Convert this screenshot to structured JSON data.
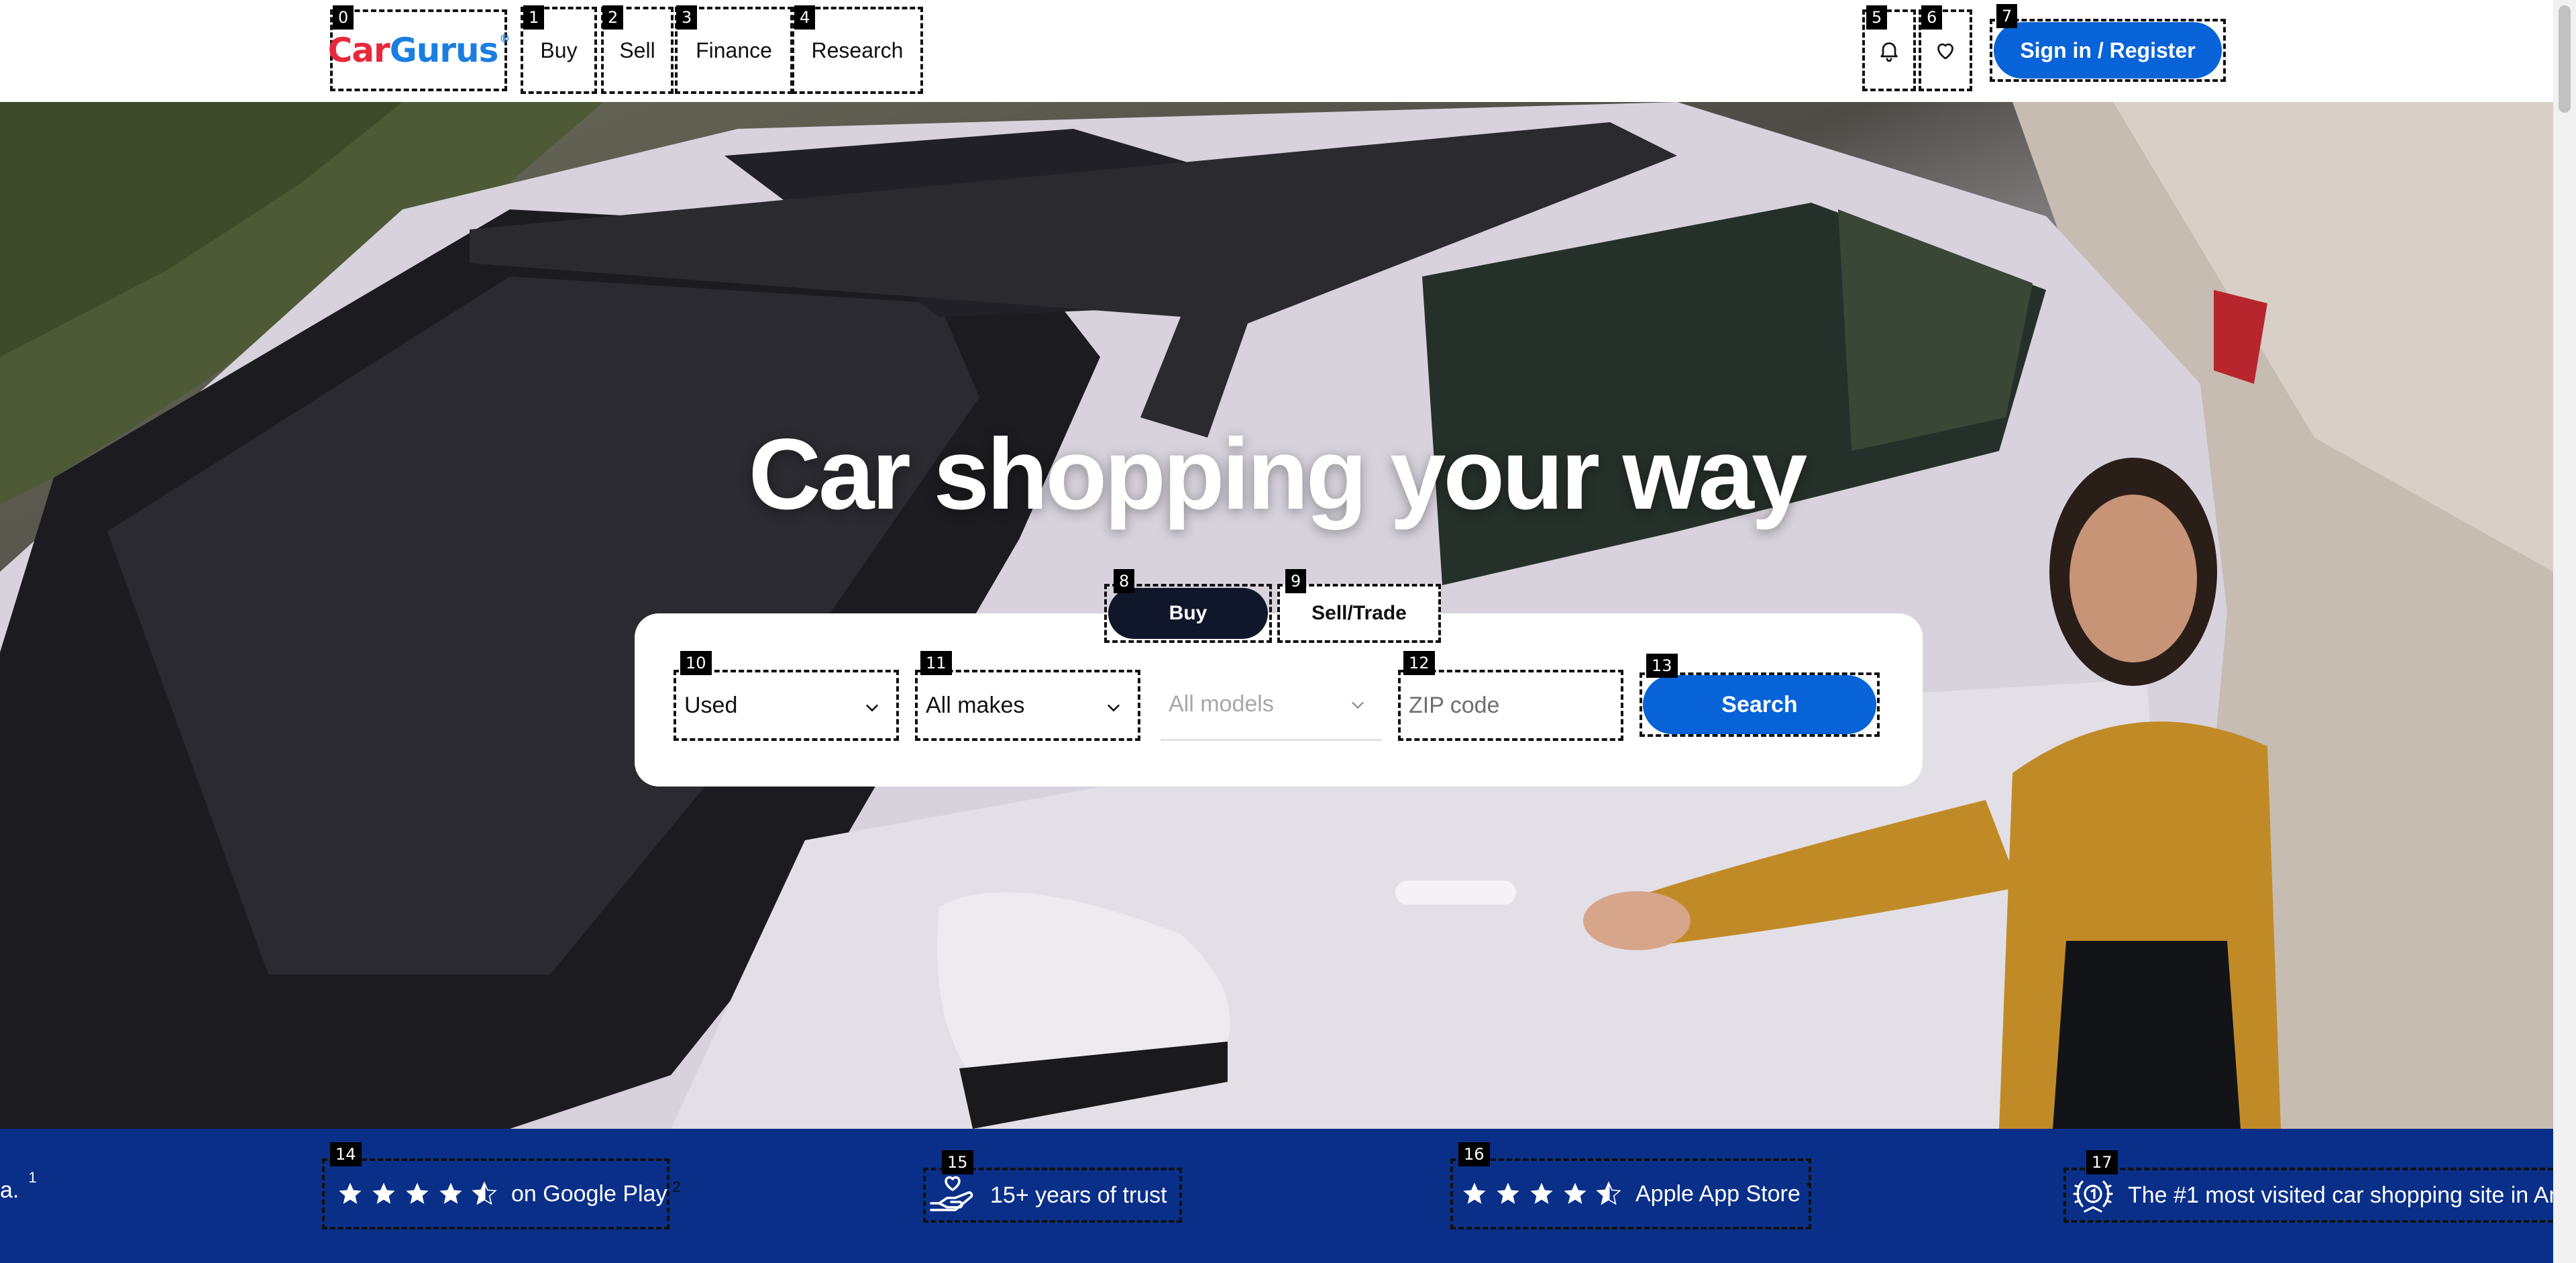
{
  "header": {
    "logo": {
      "car": "Car",
      "gurus": "Gurus",
      "mark": "®"
    },
    "nav": [
      {
        "label": "Buy"
      },
      {
        "label": "Sell"
      },
      {
        "label": "Finance"
      },
      {
        "label": "Research"
      }
    ],
    "sign_in_label": "Sign in / Register",
    "icons": {
      "notifications": "bell-icon",
      "saved": "heart-icon"
    }
  },
  "hero": {
    "title": "Car shopping your way"
  },
  "search": {
    "tabs": [
      {
        "label": "Buy",
        "selected": true
      },
      {
        "label": "Sell/Trade",
        "selected": false
      }
    ],
    "condition": {
      "value": "Used"
    },
    "make": {
      "value": "All makes"
    },
    "model": {
      "value": "All models",
      "disabled": true
    },
    "zip": {
      "placeholder": "ZIP code"
    },
    "search_label": "Search"
  },
  "trust_band": {
    "lead_fragment": "a.",
    "lead_footnote": "1",
    "items": [
      {
        "text": "on Google Play",
        "footnote": "2",
        "rating_stars": 4.5
      },
      {
        "text": "15+ years of trust",
        "footnote": ""
      },
      {
        "text": "Apple App Store",
        "footnote": "*",
        "rating_stars": 4.5
      },
      {
        "text": "The #1 most visited car shopping site in Am",
        "footnote": ""
      }
    ]
  },
  "tags": [
    "0",
    "1",
    "2",
    "3",
    "4",
    "5",
    "6",
    "7",
    "8",
    "9",
    "10",
    "11",
    "12",
    "13",
    "14",
    "15",
    "16",
    "17"
  ],
  "colors": {
    "brand_blue": "#0763d7",
    "logo_red": "#e8293c",
    "logo_blue": "#1a7ee0",
    "band_navy": "#0a2f88",
    "buy_pill": "#10172a"
  }
}
